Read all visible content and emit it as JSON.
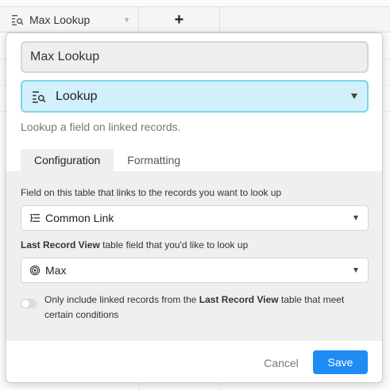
{
  "grid": {
    "column_name": "Max Lookup",
    "column_icon": "lookup-icon",
    "add_column_label": "+"
  },
  "dialog": {
    "field_name": "Max Lookup",
    "field_type": {
      "label": "Lookup",
      "icon": "lookup-icon",
      "description": "Lookup a field on linked records."
    },
    "tabs": [
      {
        "label": "Configuration",
        "active": true
      },
      {
        "label": "Formatting",
        "active": false
      }
    ],
    "config": {
      "link_field_label": "Field on this table that links to the records you want to look up",
      "link_field_value": "Common Link",
      "link_field_icon": "link-field-icon",
      "lookup_field_label_table": "Last Record View",
      "lookup_field_label_suffix": " table field that you'd like to look up",
      "lookup_field_value": "Max",
      "lookup_field_icon": "rollup-icon",
      "condition_toggle": {
        "on": false,
        "text_prefix": "Only include linked records from the ",
        "text_table": "Last Record View",
        "text_suffix": " table that meet certain conditions"
      }
    },
    "buttons": {
      "cancel": "Cancel",
      "save": "Save"
    },
    "colors": {
      "accent": "#1f8bf5",
      "type_select_bg": "#d2f0fb",
      "type_select_border": "#7fd3ef"
    }
  }
}
